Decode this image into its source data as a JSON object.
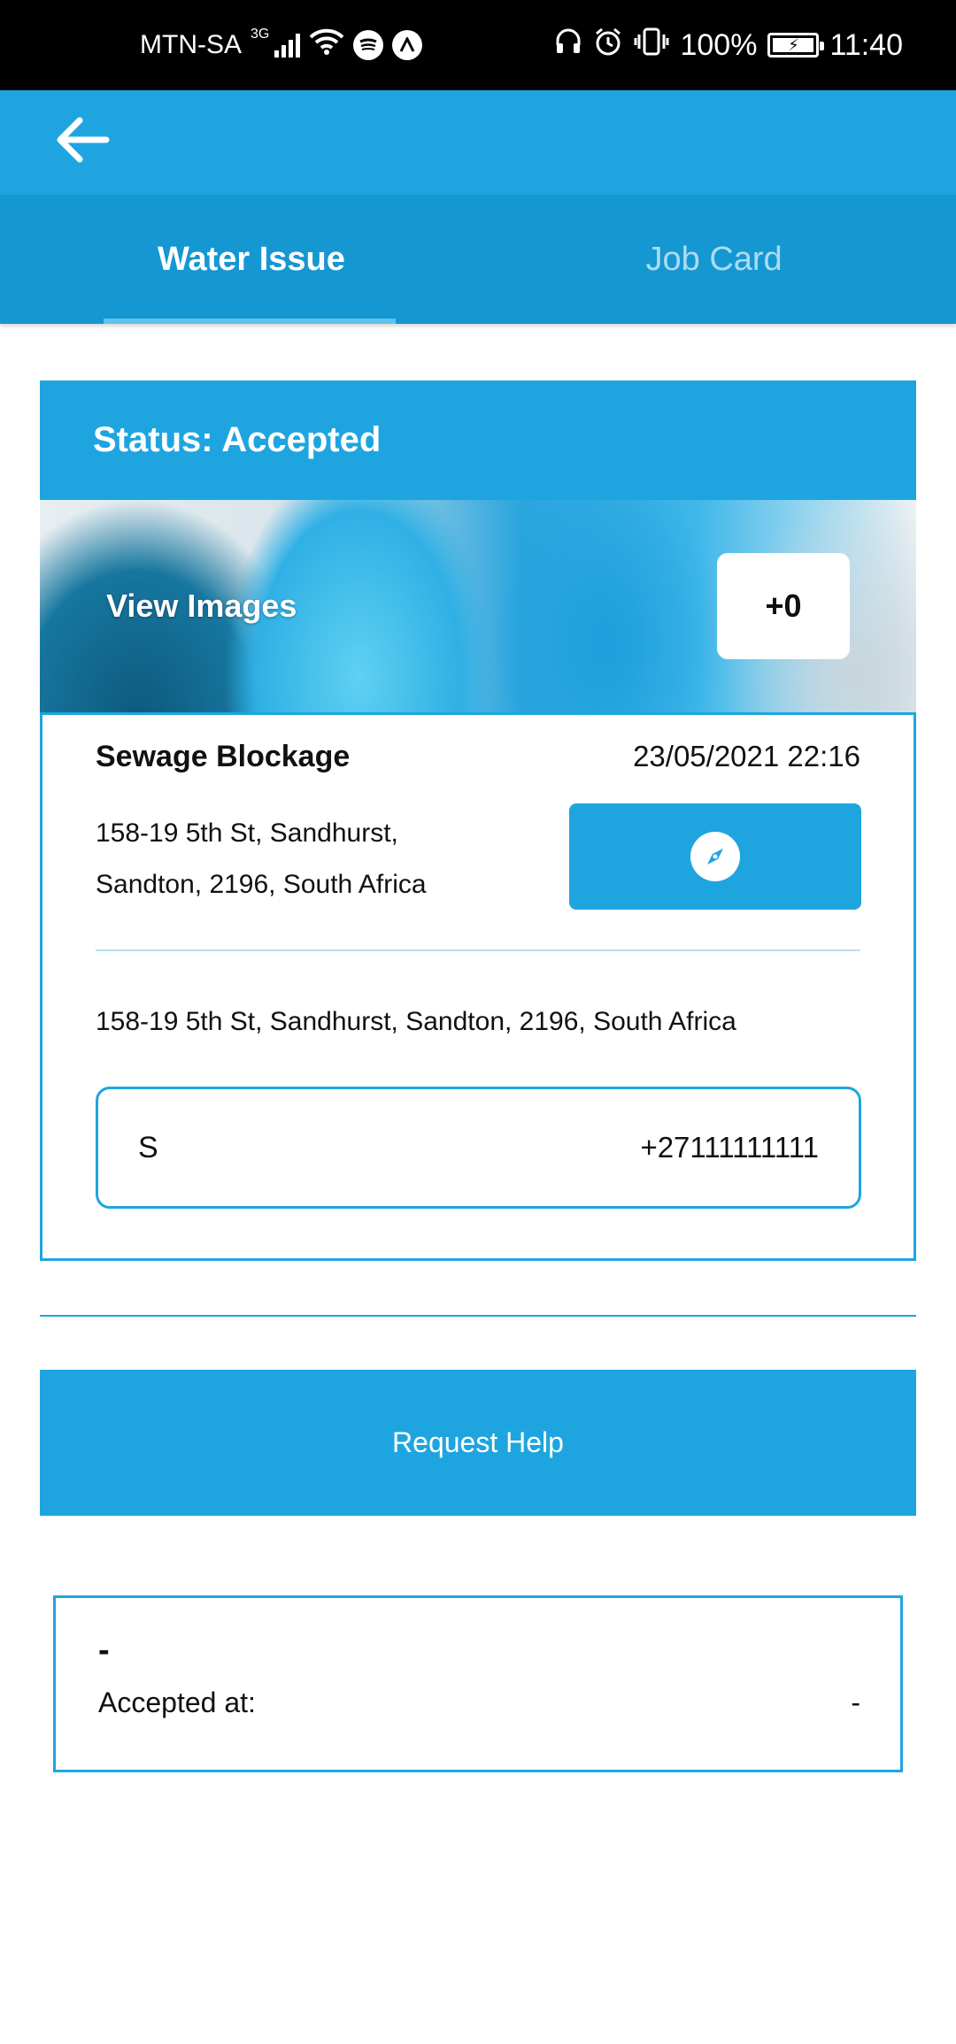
{
  "status_bar": {
    "carrier": "MTN-SA",
    "network_type": "3G",
    "battery": "100%",
    "time": "11:40",
    "icons": [
      "signal-icon",
      "wifi-icon",
      "spotify-icon",
      "nav-app-icon",
      "headphones-icon",
      "alarm-icon",
      "vibrate-icon",
      "battery-charging-icon"
    ]
  },
  "app_bar": {
    "back_icon": "arrow-left-icon"
  },
  "tabs": [
    {
      "label": "Water Issue",
      "active": true
    },
    {
      "label": "Job Card",
      "active": false
    }
  ],
  "issue": {
    "status_text": "Status: Accepted",
    "view_images_label": "View Images",
    "image_count": "+0",
    "title": "Sewage Blockage",
    "date": "23/05/2021 22:16",
    "address_short": "158-19 5th St, Sandhurst, Sandton, 2196, South Africa",
    "address_full": "158-19 5th St, Sandhurst, Sandton, 2196, South Africa",
    "navigate_icon": "compass-icon",
    "contact": {
      "name": "S",
      "phone": "+27111111111"
    }
  },
  "request_help_label": "Request Help",
  "acceptance": {
    "accepted_by": "-",
    "accepted_at_label": "Accepted at:",
    "accepted_at_value": "-"
  },
  "colors": {
    "primary": "#1ea5e0",
    "tab_bar": "#1597d2",
    "divider": "#b6e0f4"
  }
}
